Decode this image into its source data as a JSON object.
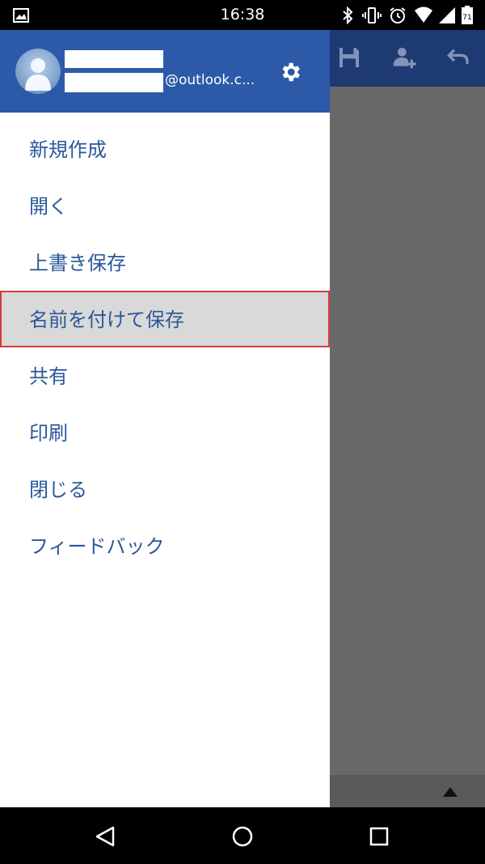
{
  "status_bar": {
    "time": "16:38",
    "battery_level": "71",
    "icons": [
      "image-notification-icon",
      "bluetooth-icon",
      "vibrate-icon",
      "alarm-icon",
      "wifi-icon",
      "signal-icon",
      "battery-icon"
    ]
  },
  "account": {
    "email_suffix": "@outlook.c..."
  },
  "menu": {
    "items": [
      {
        "label": "新規作成"
      },
      {
        "label": "開く"
      },
      {
        "label": "上書き保存"
      },
      {
        "label": "名前を付けて保存",
        "selected": true
      },
      {
        "label": "共有"
      },
      {
        "label": "印刷"
      },
      {
        "label": "閉じる"
      },
      {
        "label": "フィードバック"
      }
    ]
  },
  "toolbar": {
    "icons": [
      "save-icon",
      "add-person-icon",
      "undo-icon"
    ]
  },
  "nav_bar": {
    "icons": [
      "back-icon",
      "home-icon",
      "recents-icon"
    ]
  },
  "colors": {
    "drawer_header": "#2c5aa8",
    "app_toolbar": "#1e3a72",
    "menu_text": "#2b579a",
    "selected_bg": "#d9d9d9",
    "selected_border": "#d63b3b"
  }
}
